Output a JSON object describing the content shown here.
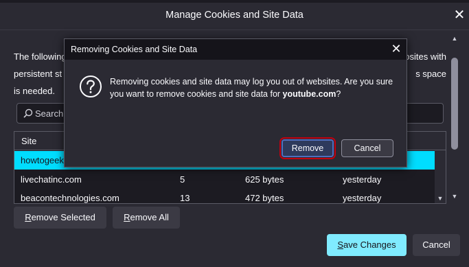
{
  "dialog": {
    "title": "Manage Cookies and Site Data",
    "description_left": [
      "The following",
      "persistent st",
      "is needed."
    ],
    "description_right": [
      "osites with",
      "s space"
    ],
    "search": {
      "placeholder": "Search"
    },
    "table": {
      "headers": [
        "Site"
      ],
      "rows": [
        {
          "site": "howtogeek",
          "cookies": "",
          "usage": "",
          "last_used": ""
        },
        {
          "site": "livechatinc.com",
          "cookies": "5",
          "usage": "625 bytes",
          "last_used": "yesterday"
        },
        {
          "site": "beacontechnologies.com",
          "cookies": "13",
          "usage": "472 bytes",
          "last_used": "yesterday"
        }
      ]
    },
    "buttons": {
      "remove_selected_u": "R",
      "remove_selected_rest": "emove Selected",
      "remove_all_u": "R",
      "remove_all_rest": "emove All",
      "save_changes_pre": "",
      "save_changes_u": "S",
      "save_changes_rest": "ave Changes",
      "cancel": "Cancel"
    }
  },
  "modal": {
    "title": "Removing Cookies and Site Data",
    "message_line1": "Removing cookies and site data may log you out of websites. Are you sure",
    "message_line2_pre": "you want to remove cookies and site data for ",
    "message_site": "youtube.com",
    "message_line2_post": "?",
    "remove_label": "Remove",
    "cancel_label": "Cancel"
  },
  "colors": {
    "accent": "#00ddff",
    "primary_button": "#80ebff",
    "focus_outline": "#c20010"
  }
}
